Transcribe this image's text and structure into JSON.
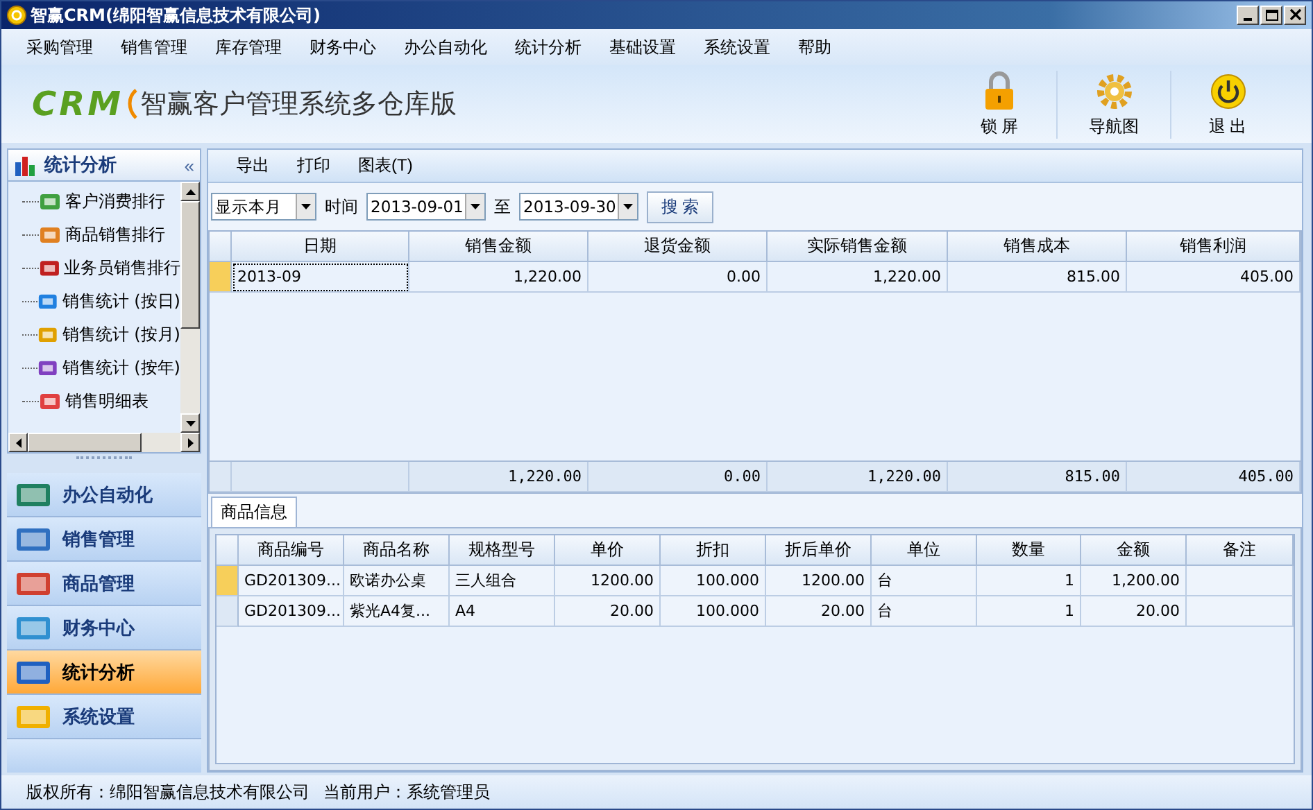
{
  "window": {
    "title": "智赢CRM(绵阳智赢信息技术有限公司)"
  },
  "menu": [
    "采购管理",
    "销售管理",
    "库存管理",
    "财务中心",
    "办公自动化",
    "统计分析",
    "基础设置",
    "系统设置",
    "帮助"
  ],
  "banner": {
    "logo": "CRM",
    "title": "智赢客户管理系统多仓库版"
  },
  "actions": [
    {
      "kind": "lock",
      "label": "锁 屏"
    },
    {
      "kind": "gear",
      "label": "导航图"
    },
    {
      "kind": "power",
      "label": "退 出"
    }
  ],
  "sidebar": {
    "title": "统计分析",
    "collapse": "«",
    "tree": [
      {
        "label": "客户消费排行"
      },
      {
        "label": "商品销售排行"
      },
      {
        "label": "业务员销售排行"
      },
      {
        "label": "销售统计 (按日)"
      },
      {
        "label": "销售统计 (按月)"
      },
      {
        "label": "销售统计 (按年)"
      },
      {
        "label": "销售明细表"
      }
    ],
    "groups": [
      {
        "label": "办公自动化",
        "selected": false
      },
      {
        "label": "销售管理",
        "selected": false
      },
      {
        "label": "商品管理",
        "selected": false
      },
      {
        "label": "财务中心",
        "selected": false
      },
      {
        "label": "统计分析",
        "selected": true
      },
      {
        "label": "系统设置",
        "selected": false
      }
    ]
  },
  "toolbar": [
    "导出",
    "打印",
    "图表(T)"
  ],
  "filter": {
    "period": "显示本月",
    "time_label": "时间",
    "from": "2013-09-01",
    "to_label": "至",
    "to": "2013-09-30",
    "search": "搜 索"
  },
  "summary": {
    "columns": [
      "日期",
      "销售金额",
      "退货金额",
      "实际销售金额",
      "销售成本",
      "销售利润"
    ],
    "rows": [
      {
        "cells": [
          "2013-09",
          "1,220.00",
          "0.00",
          "1,220.00",
          "815.00",
          "405.00"
        ],
        "selected": true
      }
    ],
    "totals": [
      "1,220.00",
      "0.00",
      "1,220.00",
      "815.00",
      "405.00"
    ]
  },
  "detail": {
    "tab": "商品信息",
    "columns": [
      "商品编号",
      "商品名称",
      "规格型号",
      "单价",
      "折扣",
      "折后单价",
      "单位",
      "数量",
      "金额",
      "备注"
    ],
    "rows": [
      {
        "cells": [
          "GD201309...",
          "欧诺办公桌",
          "三人组合",
          "1200.00",
          "100.000",
          "1200.00",
          "台",
          "1",
          "1,200.00",
          ""
        ],
        "selected": true
      },
      {
        "cells": [
          "GD201309...",
          "紫光A4复...",
          "A4",
          "20.00",
          "100.000",
          "20.00",
          "台",
          "1",
          "20.00",
          ""
        ],
        "selected": false
      }
    ]
  },
  "status_bar": [
    "版权所有：绵阳智赢信息技术有限公司",
    "当前用户：系统管理员"
  ]
}
